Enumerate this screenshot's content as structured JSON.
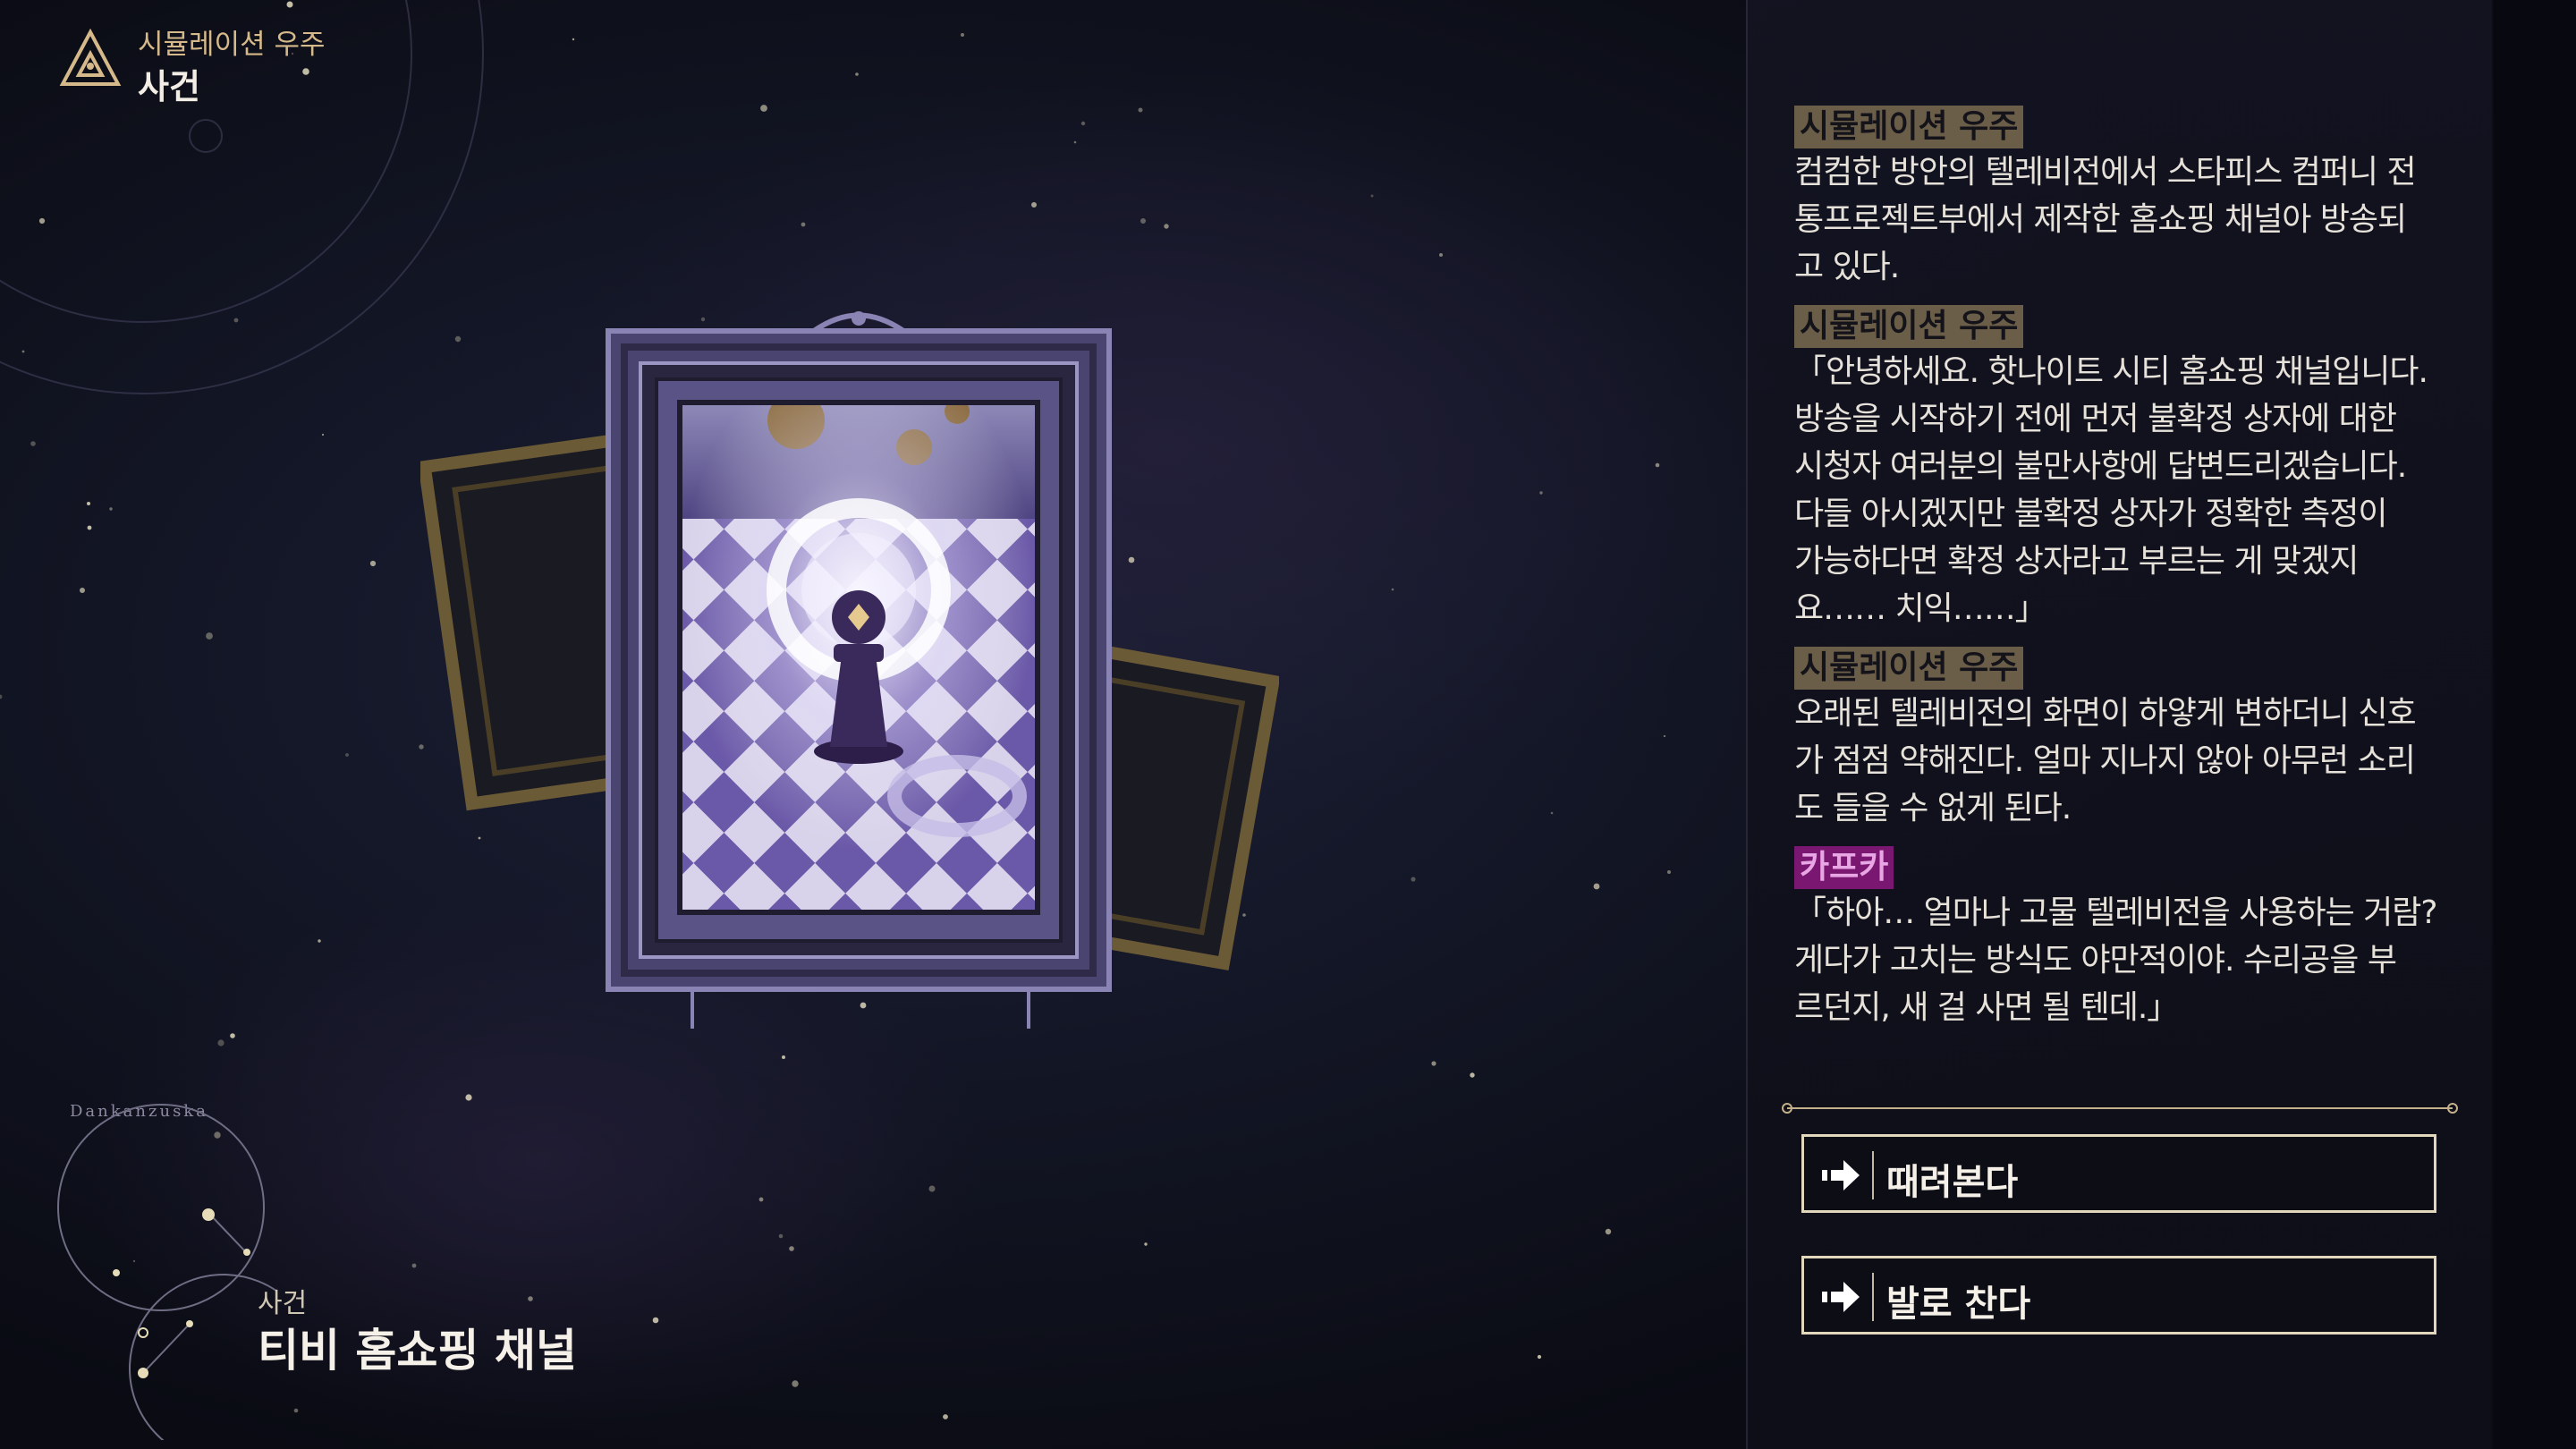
{
  "header": {
    "subtitle": "시뮬레이션 우주",
    "title": "사건"
  },
  "event": {
    "category": "사건",
    "title": "티비 홈쇼핑 채널",
    "constellation_label": "Dankanzuska"
  },
  "dialogue": [
    {
      "speaker": "시뮬레이션 우주",
      "speaker_type": "narrator",
      "lines": [
        "컴컴한 방안의 텔레비전에서 스타피스 컴퍼니 전",
        "통프로젝트부에서 제작한 홈쇼핑 채널아 방송되",
        "고 있다."
      ]
    },
    {
      "speaker": "시뮬레이션 우주",
      "speaker_type": "narrator",
      "lines": [
        "「안녕하세요. 핫나이트 시티 홈쇼핑 채널입니다.",
        "방송을 시작하기 전에 먼저 불확정 상자에 대한",
        "시청자 여러분의 불만사항에 답변드리겠습니다.",
        "다들 아시겠지만 불확정 상자가 정확한 측정이",
        "가능하다면 확정 상자라고 부르는 게 맞겠지",
        "요…… 치익……」"
      ]
    },
    {
      "speaker": "시뮬레이션 우주",
      "speaker_type": "narrator",
      "lines": [
        "오래된 텔레비전의 화면이 하얗게 변하더니 신호",
        "가 점점 약해진다. 얼마 지나지 않아 아무런 소리",
        "도 들을 수 없게 된다."
      ]
    },
    {
      "speaker": "카프카",
      "speaker_type": "character",
      "lines": [
        "「하아… 얼마나 고물 텔레비전을 사용하는 거람?",
        "게다가 고치는 방식도 야만적이야. 수리공을 부",
        "르던지, 새 걸 사면 될 텐데.」"
      ]
    }
  ],
  "options": [
    {
      "label": "때려본다",
      "icon": "arrow-right-icon"
    },
    {
      "label": "발로 찬다",
      "icon": "arrow-right-icon"
    }
  ],
  "colors": {
    "accent_gold": "#d6b98a",
    "narrator_tag": "#6b5e49",
    "kafka_tag": "#7a1770",
    "art_purple": "#5a4a96"
  }
}
